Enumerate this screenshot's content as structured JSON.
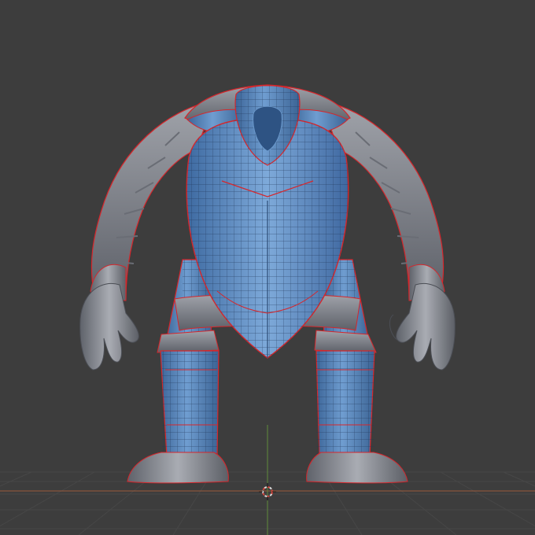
{
  "viewport": {
    "background": "#3d3d3d",
    "grid_color": "#474747",
    "x_axis_color": "#9b5a3c",
    "z_axis_color": "#5f8a3c",
    "cursor_colors": [
      "#d8d8d8",
      "#d2453c"
    ]
  },
  "model": {
    "body_color": "#4f7cb4",
    "armor_color": "#8a8d95",
    "seam_color": "#d6262b",
    "wire_color": "#1f3556"
  }
}
